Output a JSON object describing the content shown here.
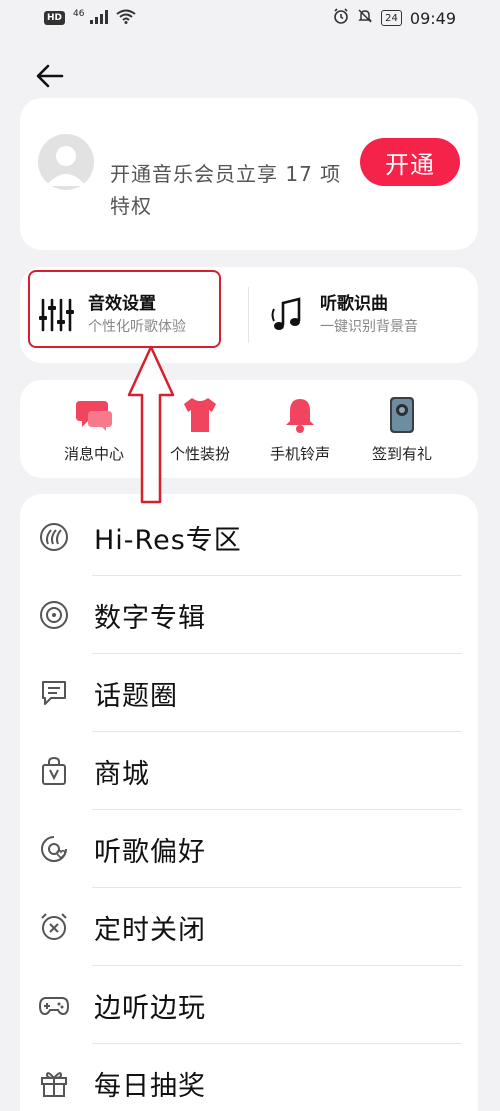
{
  "status_bar": {
    "hd": "HD",
    "signal_label": "46",
    "battery": "24",
    "time": "09:49"
  },
  "member": {
    "promo_text": "开通音乐会员立享 17 项特权",
    "open_label": "开通"
  },
  "features": [
    {
      "title": "音效设置",
      "subtitle": "个性化听歌体验",
      "icon": "equalizer-icon"
    },
    {
      "title": "听歌识曲",
      "subtitle": "一键识别背景音",
      "icon": "music-note-icon"
    }
  ],
  "shortcuts": [
    {
      "label": "消息中心",
      "icon": "message-bubble-icon"
    },
    {
      "label": "个性装扮",
      "icon": "tshirt-icon"
    },
    {
      "label": "手机铃声",
      "icon": "bell-icon"
    },
    {
      "label": "签到有礼",
      "icon": "phone-image-icon"
    }
  ],
  "menu": [
    {
      "label": "Hi-Res专区",
      "icon": "hires-icon"
    },
    {
      "label": "数字专辑",
      "icon": "disc-icon"
    },
    {
      "label": "话题圈",
      "icon": "chat-icon"
    },
    {
      "label": "商城",
      "icon": "shopping-bag-icon"
    },
    {
      "label": "听歌偏好",
      "icon": "preference-heart-icon"
    },
    {
      "label": "定时关闭",
      "icon": "alarm-clock-icon"
    },
    {
      "label": "边听边玩",
      "icon": "gamepad-icon"
    },
    {
      "label": "每日抽奖",
      "icon": "gift-icon"
    }
  ],
  "colors": {
    "accent": "#f5224a",
    "annotation": "#d6202e",
    "background": "#f2f2f5"
  }
}
